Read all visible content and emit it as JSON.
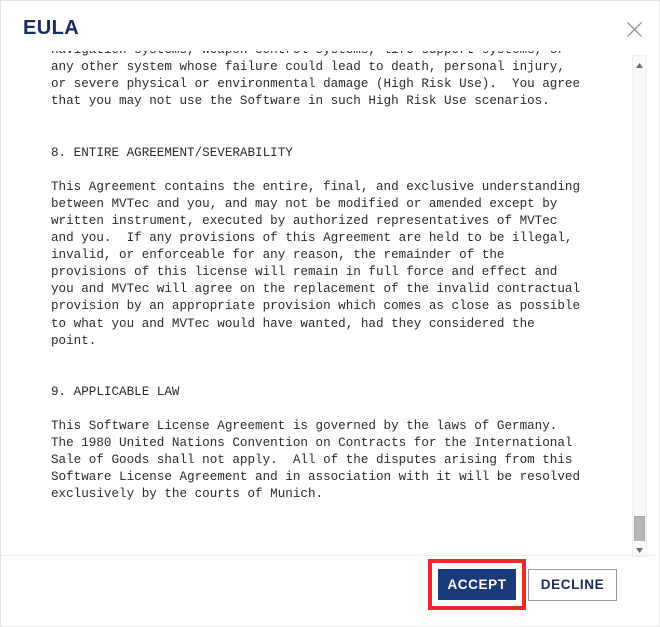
{
  "dialog": {
    "title": "EULA",
    "close_icon": "close-icon"
  },
  "scrollbar": {
    "up_arrow_icon": "triangle-up-icon",
    "down_arrow_icon": "triangle-down-icon"
  },
  "eula": {
    "lines": [
      "navigation systems, weapon control systems, life support systems, or",
      "any other system whose failure could lead to death, personal injury,",
      "or severe physical or environmental damage (High Risk Use).  You agree",
      "that you may not use the Software in such High Risk Use scenarios.",
      "",
      "",
      "8. ENTIRE AGREEMENT/SEVERABILITY",
      "",
      "This Agreement contains the entire, final, and exclusive understanding",
      "between MVTec and you, and may not be modified or amended except by",
      "written instrument, executed by authorized representatives of MVTec",
      "and you.  If any provisions of this Agreement are held to be illegal,",
      "invalid, or enforceable for any reason, the remainder of the",
      "provisions of this license will remain in full force and effect and",
      "you and MVTec will agree on the replacement of the invalid contractual",
      "provision by an appropriate provision which comes as close as possible",
      "to what you and MVTec would have wanted, had they considered the",
      "point.",
      "",
      "",
      "9. APPLICABLE LAW",
      "",
      "This Software License Agreement is governed by the laws of Germany.",
      "The 1980 United Nations Convention on Contracts for the International",
      "Sale of Goods shall not apply.  All of the disputes arising from this",
      "Software License Agreement and in association with it will be resolved",
      "exclusively by the courts of Munich."
    ]
  },
  "footer": {
    "accept_label": "ACCEPT",
    "decline_label": "DECLINE"
  },
  "colors": {
    "title_navy": "#1b2b63",
    "accept_navy": "#1b3a7a",
    "highlight_red": "#ee2828",
    "text_gray": "#2b2b2b"
  }
}
